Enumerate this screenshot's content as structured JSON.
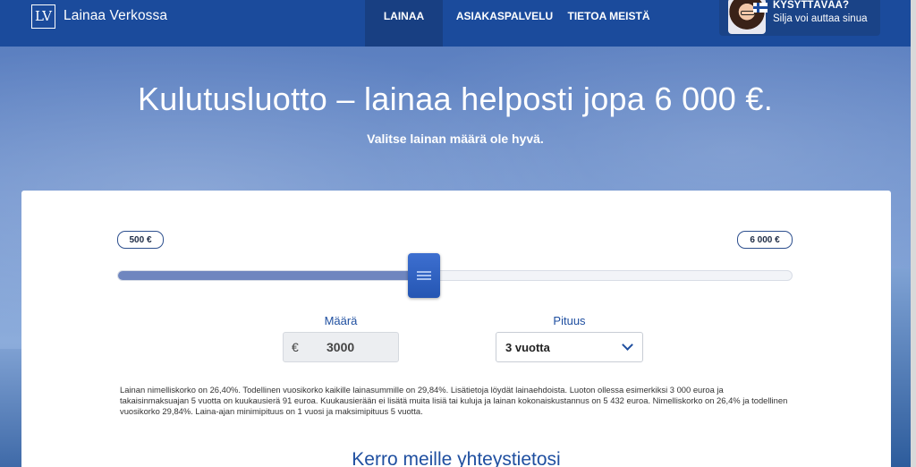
{
  "header": {
    "logo_mark": "LV",
    "logo_text": "Lainaa Verkossa",
    "nav": [
      {
        "label": "LAINAA",
        "active": true
      },
      {
        "label": "ASIAKASPALVELU",
        "active": false
      },
      {
        "label": "TIETOA MEISTÄ",
        "active": false
      }
    ],
    "help": {
      "title": "KYSYTTÄVÄÄ?",
      "subtitle": "Silja voi auttaa sinua"
    }
  },
  "hero": {
    "title": "Kulutusluotto – lainaa helposti jopa 6 000 €.",
    "subtitle": "Valitse lainan määrä ole hyvä."
  },
  "calculator": {
    "min_label": "500 €",
    "max_label": "6 000 €",
    "slider_fraction": 0.4545,
    "amount_label": "Määrä",
    "currency_symbol": "€",
    "amount_value": "3000",
    "duration_label": "Pituus",
    "duration_value": "3 vuotta",
    "disclaimer": "Lainan nimelliskorko on 26,40%. Todellinen vuosikorko kaikille lainasummille on 29,84%. Lisätietoja löydät lainaehdoista. Luoton ollessa esimerkiksi 3 000 euroa ja takaisinmaksuajan 5 vuotta on kuukausierä 91 euroa. Kuukausierään ei lisätä muita lisiä tai kuluja ja lainan kokonaiskustannus on 5 432 euroa. Nimelliskorko on 26,4% ja todellinen vuosikorko 29,84%. Laina-ajan minimipituus on 1 vuosi ja maksimipituus 5 vuotta."
  },
  "contact_section": {
    "title": "Kerro meille yhteystietosi"
  },
  "colors": {
    "header_bg": "#1b4b9c",
    "accent": "#1f4fa0",
    "slider_handle": "#2d60c0"
  }
}
